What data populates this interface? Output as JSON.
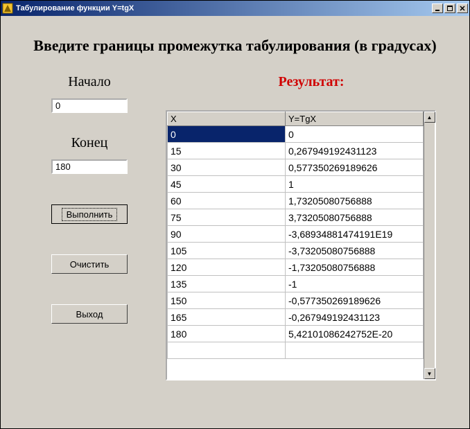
{
  "window": {
    "title": "Табулирование функции Y=tgX"
  },
  "heading": "Введите границы промежутка табулирования (в градусах)",
  "labels": {
    "start": "Начало",
    "end": "Конец",
    "result": "Результат:"
  },
  "inputs": {
    "start_value": "0",
    "end_value": "180"
  },
  "buttons": {
    "execute": "Выполнить",
    "clear": "Очистить",
    "exit": "Выход"
  },
  "grid": {
    "headers": {
      "x": "X",
      "y": "Y=TgX"
    },
    "rows": [
      {
        "x": "0",
        "y": "0"
      },
      {
        "x": "15",
        "y": "0,267949192431123"
      },
      {
        "x": "30",
        "y": "0,577350269189626"
      },
      {
        "x": "45",
        "y": "1"
      },
      {
        "x": "60",
        "y": "1,73205080756888"
      },
      {
        "x": "75",
        "y": "3,73205080756888"
      },
      {
        "x": "90",
        "y": "-3,68934881474191E19"
      },
      {
        "x": "105",
        "y": "-3,73205080756888"
      },
      {
        "x": "120",
        "y": "-1,73205080756888"
      },
      {
        "x": "135",
        "y": "-1"
      },
      {
        "x": "150",
        "y": "-0,577350269189626"
      },
      {
        "x": "165",
        "y": "-0,267949192431123"
      },
      {
        "x": "180",
        "y": "5,42101086242752E-20"
      }
    ],
    "selected_index": 0
  },
  "chart_data": {
    "type": "table",
    "title": "Табулирование функции Y=tgX",
    "columns": [
      "X",
      "Y=TgX"
    ],
    "x": [
      0,
      15,
      30,
      45,
      60,
      75,
      90,
      105,
      120,
      135,
      150,
      165,
      180
    ],
    "y": [
      0,
      0.267949192431123,
      0.577350269189626,
      1,
      1.73205080756888,
      3.73205080756888,
      -3.68934881474191e+19,
      -3.73205080756888,
      -1.73205080756888,
      -1,
      -0.577350269189626,
      -0.267949192431123,
      5.42101086242752e-20
    ]
  }
}
